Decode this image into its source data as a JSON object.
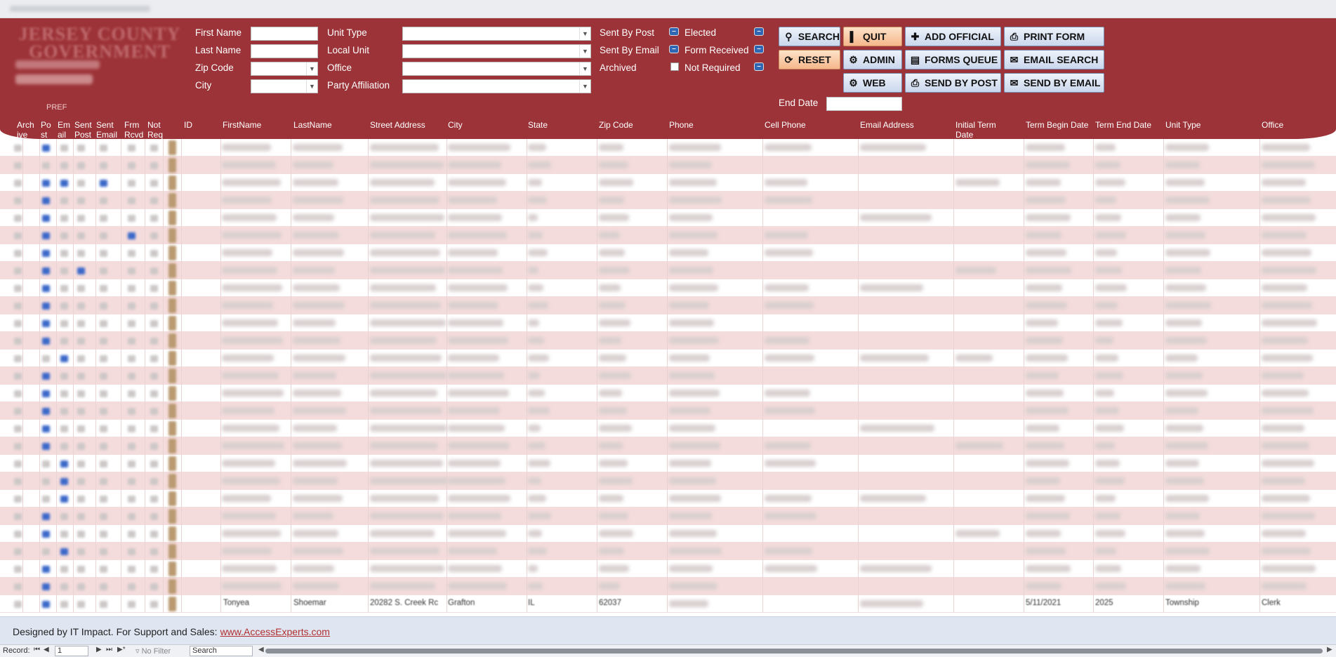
{
  "header": {
    "logo_line1": "JERSEY COUNTY",
    "logo_line2": "GOVERNMENT"
  },
  "search_form": {
    "first_name_label": "First Name",
    "last_name_label": "Last Name",
    "zip_code_label": "Zip Code",
    "city_label": "City",
    "unit_type_label": "Unit Type",
    "local_unit_label": "Local Unit",
    "office_label": "Office",
    "party_affiliation_label": "Party Affiliation",
    "sent_by_post_label": "Sent By Post",
    "sent_by_email_label": "Sent By Email",
    "archived_label": "Archived",
    "elected_label": "Elected",
    "form_received_label": "Form Received",
    "not_required_label": "Not Required",
    "end_date_label": "End Date"
  },
  "buttons": {
    "search": "SEARCH",
    "quit": "QUIT",
    "add_official": "ADD OFFICIAL",
    "print_form": "PRINT FORM",
    "reset": "RESET",
    "admin": "ADMIN",
    "forms_queue": "FORMS QUEUE",
    "email_search": "EMAIL SEARCH",
    "web": "WEB",
    "send_by_post": "SEND BY POST",
    "send_by_email": "SEND BY EMAIL"
  },
  "grid": {
    "pref_label": "PREF",
    "columns": {
      "archive": "Arch\nive",
      "post": "Po\nst",
      "email": "Em\nail",
      "sent_post": "Sent\nPost",
      "sent_email": "Sent\nEmail",
      "frm_rcvd": "Frm\nRcvd",
      "not_req": "Not\nReq",
      "id": "ID",
      "first_name": "FirstName",
      "last_name": "LastName",
      "street_address": "Street Address",
      "city": "City",
      "state": "State",
      "zip_code": "Zip Code",
      "phone": "Phone",
      "cell_phone": "Cell Phone",
      "email_address": "Email Address",
      "initial_term_date": "Initial Term\nDate",
      "term_begin_date": "Term Begin Date",
      "term_end_date": "Term End Date",
      "unit_type": "Unit Type",
      "office": "Office"
    },
    "last_row": {
      "first_name": "Tonyea",
      "last_name": "Shoemar",
      "street_address": "20282 S. Creek Rc",
      "city": "Grafton",
      "state": "IL",
      "zip_code": "62037",
      "term_begin_date": "5/11/2021",
      "term_end_date": "2025",
      "unit_type": "Township",
      "office": "Clerk"
    }
  },
  "footer": {
    "designed_by": "Designed by IT Impact. For Support and Sales:",
    "link": "www.AccessExperts.com"
  },
  "record_nav": {
    "record_label": "Record:",
    "current": "1",
    "no_filter": "No Filter",
    "search": "Search"
  }
}
